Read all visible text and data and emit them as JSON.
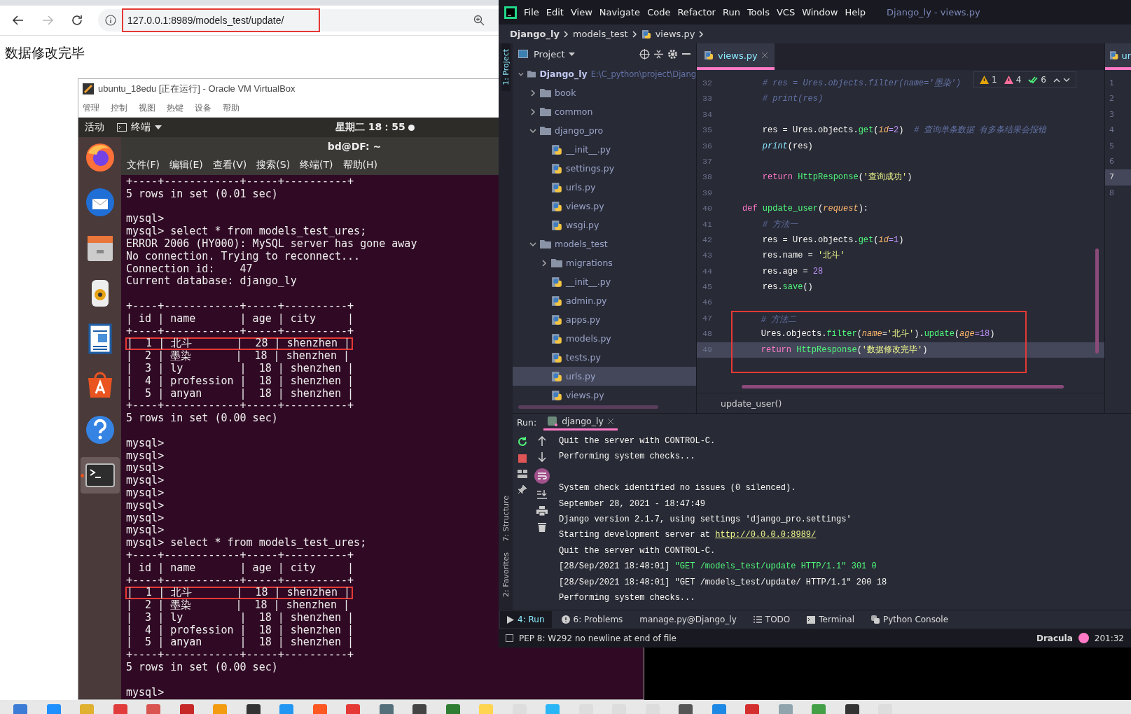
{
  "browser": {
    "nav": [
      {
        "kind": "back",
        "disabled": false
      },
      {
        "kind": "forward",
        "disabled": true
      },
      {
        "kind": "reload",
        "disabled": false
      }
    ],
    "address": "127.0.0.1:8989/models_test/update/",
    "address_highlighted": true,
    "page_text": "数据修改完毕"
  },
  "virtualbox": {
    "title": "ubuntu_18edu [正在运行] - Oracle VM VirtualBox",
    "menu": [
      "管理",
      "控制",
      "视图",
      "热键",
      "设备",
      "帮助"
    ],
    "top_bar": {
      "activities": "活动",
      "app": "终端",
      "clock": "星期二 18：55"
    },
    "dock": [
      {
        "kind": "firefox",
        "active": false
      },
      {
        "kind": "mail",
        "active": false
      },
      {
        "kind": "files",
        "active": false
      },
      {
        "kind": "speaker",
        "active": false
      },
      {
        "kind": "document",
        "active": false
      },
      {
        "kind": "store",
        "active": false
      },
      {
        "kind": "help",
        "active": false
      },
      {
        "kind": "terminal",
        "active": true
      }
    ],
    "terminal": {
      "title": "bd@DF: ~",
      "menu": [
        "文件(F)",
        "编辑(E)",
        "查看(V)",
        "搜索(S)",
        "终端(T)",
        "帮助(H)"
      ],
      "lines": [
        {
          "text": "+----+------------+-----+----------+",
          "highlighted": false
        },
        {
          "text": "5 rows in set (0.01 sec)",
          "highlighted": false
        },
        {
          "kind": "blank"
        },
        {
          "text": "mysql>",
          "highlighted": false
        },
        {
          "text": "mysql> select * from models_test_ures;",
          "highlighted": false
        },
        {
          "text": "ERROR 2006 (HY000): MySQL server has gone away",
          "highlighted": false
        },
        {
          "text": "No connection. Trying to reconnect...",
          "highlighted": false
        },
        {
          "text": "Connection id:    47",
          "highlighted": false
        },
        {
          "text": "Current database: django_ly",
          "highlighted": false
        },
        {
          "kind": "blank"
        },
        {
          "text": "+----+------------+-----+----------+",
          "highlighted": false
        },
        {
          "text": "| id | name       | age | city     |",
          "highlighted": false
        },
        {
          "text": "+----+------------+-----+----------+",
          "highlighted": false
        },
        {
          "text": "|  1 | 北斗       |  28 | shenzhen |",
          "highlighted": true
        },
        {
          "text": "|  2 | 墨染       |  18 | shenzhen |",
          "highlighted": false
        },
        {
          "text": "|  3 | ly         |  18 | shenzhen |",
          "highlighted": false
        },
        {
          "text": "|  4 | profession |  18 | shenzhen |",
          "highlighted": false
        },
        {
          "text": "|  5 | anyan      |  18 | shenzhen |",
          "highlighted": false
        },
        {
          "text": "+----+------------+-----+----------+",
          "highlighted": false
        },
        {
          "text": "5 rows in set (0.00 sec)",
          "highlighted": false
        },
        {
          "kind": "blank"
        },
        {
          "text": "mysql>",
          "highlighted": false
        },
        {
          "text": "mysql>",
          "highlighted": false
        },
        {
          "text": "mysql>",
          "highlighted": false
        },
        {
          "text": "mysql>",
          "highlighted": false
        },
        {
          "text": "mysql>",
          "highlighted": false
        },
        {
          "text": "mysql>",
          "highlighted": false
        },
        {
          "text": "mysql>",
          "highlighted": false
        },
        {
          "text": "mysql>",
          "highlighted": false
        },
        {
          "text": "mysql> select * from models_test_ures;",
          "highlighted": false
        },
        {
          "text": "+----+------------+-----+----------+",
          "highlighted": false
        },
        {
          "text": "| id | name       | age | city     |",
          "highlighted": false
        },
        {
          "text": "+----+------------+-----+----------+",
          "highlighted": false
        },
        {
          "text": "|  1 | 北斗       |  18 | shenzhen |",
          "highlighted": true
        },
        {
          "text": "|  2 | 墨染       |  18 | shenzhen |",
          "highlighted": false
        },
        {
          "text": "|  3 | ly         |  18 | shenzhen |",
          "highlighted": false
        },
        {
          "text": "|  4 | profession |  18 | shenzhen |",
          "highlighted": false
        },
        {
          "text": "|  5 | anyan      |  18 | shenzhen |",
          "highlighted": false
        },
        {
          "text": "+----+------------+-----+----------+",
          "highlighted": false
        },
        {
          "text": "5 rows in set (0.00 sec)",
          "highlighted": false
        },
        {
          "kind": "blank"
        },
        {
          "text": "mysql>",
          "highlighted": false
        }
      ]
    }
  },
  "pycharm": {
    "menu": [
      "File",
      "Edit",
      "View",
      "Navigate",
      "Code",
      "Refactor",
      "Run",
      "Tools",
      "VCS",
      "Window",
      "Help"
    ],
    "title": "Django_ly - views.py",
    "breadcrumb": [
      "Django_ly",
      "models_test",
      "views.py"
    ],
    "left_strip": [
      {
        "label": "1: Project",
        "selected": true
      },
      {
        "label": "7: Structure",
        "selected": false
      },
      {
        "label": "2: Favorites",
        "selected": false
      }
    ],
    "project": {
      "title": "Project",
      "tree": [
        {
          "label": "Django_ly",
          "path": "E:\\C_python\\project\\Djang",
          "kind": "root",
          "expanded": true,
          "selected": false,
          "children": [
            {
              "label": "book",
              "kind": "folder",
              "expanded": false,
              "selected": false
            },
            {
              "label": "common",
              "kind": "folder",
              "expanded": false,
              "selected": false
            },
            {
              "label": "django_pro",
              "kind": "folder",
              "expanded": true,
              "selected": false,
              "children": [
                {
                  "label": "__init__.py",
                  "kind": "python",
                  "selected": false
                },
                {
                  "label": "settings.py",
                  "kind": "python",
                  "selected": false
                },
                {
                  "label": "urls.py",
                  "kind": "python",
                  "selected": false
                },
                {
                  "label": "views.py",
                  "kind": "python",
                  "selected": false
                },
                {
                  "label": "wsgi.py",
                  "kind": "python",
                  "selected": false
                }
              ]
            },
            {
              "label": "models_test",
              "kind": "folder",
              "expanded": true,
              "selected": false,
              "children": [
                {
                  "label": "migrations",
                  "kind": "folder",
                  "expanded": false,
                  "selected": false
                },
                {
                  "label": "__init__.py",
                  "kind": "python",
                  "selected": false
                },
                {
                  "label": "admin.py",
                  "kind": "python",
                  "selected": false
                },
                {
                  "label": "apps.py",
                  "kind": "python",
                  "selected": false
                },
                {
                  "label": "models.py",
                  "kind": "python",
                  "selected": false
                },
                {
                  "label": "tests.py",
                  "kind": "python",
                  "selected": false
                },
                {
                  "label": "urls.py",
                  "kind": "python",
                  "selected": true
                },
                {
                  "label": "views.py",
                  "kind": "python",
                  "selected": false
                }
              ]
            }
          ]
        }
      ]
    },
    "editor": {
      "tab": {
        "label": "views.py",
        "selected": true
      },
      "inspections": [
        {
          "kind": "warning",
          "count": "1"
        },
        {
          "kind": "error",
          "count": "4"
        },
        {
          "kind": "ok",
          "count": "6"
        }
      ],
      "lines": [
        {
          "num": "32",
          "current": false,
          "boxed": false,
          "tokens": [
            {
              "kind": "cmt",
              "text": "    # res = Ures.objects.filter(name='墨染')"
            }
          ]
        },
        {
          "num": "33",
          "current": false,
          "boxed": false,
          "tokens": [
            {
              "kind": "cmt",
              "text": "    # print(res)"
            }
          ]
        },
        {
          "num": "34",
          "current": false,
          "boxed": false
        },
        {
          "num": "35",
          "current": false,
          "boxed": false,
          "tokens": [
            {
              "kind": "plain",
              "text": "    res = Ures.objects."
            },
            {
              "kind": "fn",
              "text": "get"
            },
            {
              "kind": "plain",
              "text": "("
            },
            {
              "kind": "param",
              "text": "id"
            },
            {
              "kind": "num",
              "text": "=2"
            },
            {
              "kind": "plain",
              "text": ")  "
            },
            {
              "kind": "cmt",
              "text": "# 查询单条数据 有多条结果会报错"
            }
          ]
        },
        {
          "num": "36",
          "current": false,
          "boxed": false,
          "tokens": [
            {
              "kind": "builtin",
              "text": "    print"
            },
            {
              "kind": "plain",
              "text": "(res)"
            }
          ]
        },
        {
          "num": "37",
          "current": false,
          "boxed": false
        },
        {
          "num": "38",
          "current": false,
          "boxed": false,
          "tokens": [
            {
              "kind": "kw",
              "text": "    return "
            },
            {
              "kind": "fn",
              "text": "HttpResponse"
            },
            {
              "kind": "plain",
              "text": "("
            },
            {
              "kind": "str",
              "text": "'查询成功'"
            },
            {
              "kind": "plain",
              "text": ")"
            }
          ]
        },
        {
          "num": "39",
          "current": false,
          "boxed": false
        },
        {
          "num": "40",
          "current": false,
          "boxed": false,
          "tokens": [
            {
              "kind": "kw",
              "text": "def "
            },
            {
              "kind": "fn",
              "text": "update_user"
            },
            {
              "kind": "plain",
              "text": "("
            },
            {
              "kind": "param",
              "text": "request"
            },
            {
              "kind": "plain",
              "text": "):"
            }
          ]
        },
        {
          "num": "41",
          "current": false,
          "boxed": false,
          "tokens": [
            {
              "kind": "cmt",
              "text": "    # 方法一"
            }
          ]
        },
        {
          "num": "42",
          "current": false,
          "boxed": false,
          "tokens": [
            {
              "kind": "plain",
              "text": "    res = Ures.objects."
            },
            {
              "kind": "fn",
              "text": "get"
            },
            {
              "kind": "plain",
              "text": "("
            },
            {
              "kind": "param",
              "text": "id"
            },
            {
              "kind": "num",
              "text": "=1"
            },
            {
              "kind": "plain",
              "text": ")"
            }
          ]
        },
        {
          "num": "43",
          "current": false,
          "boxed": false,
          "tokens": [
            {
              "kind": "plain",
              "text": "    res.name = "
            },
            {
              "kind": "str",
              "text": "'北斗'"
            }
          ]
        },
        {
          "num": "44",
          "current": false,
          "boxed": false,
          "tokens": [
            {
              "kind": "plain",
              "text": "    res.age = "
            },
            {
              "kind": "num",
              "text": "28"
            }
          ]
        },
        {
          "num": "45",
          "current": false,
          "boxed": false,
          "tokens": [
            {
              "kind": "plain",
              "text": "    res."
            },
            {
              "kind": "fn",
              "text": "save"
            },
            {
              "kind": "plain",
              "text": "()"
            }
          ]
        },
        {
          "num": "46",
          "current": false,
          "boxed": false
        },
        {
          "num": "47",
          "current": false,
          "boxed": true,
          "tokens": [
            {
              "kind": "cmt",
              "text": "    # 方法二"
            }
          ]
        },
        {
          "num": "48",
          "current": false,
          "boxed": true,
          "tokens": [
            {
              "kind": "plain",
              "text": "    Ures.objects."
            },
            {
              "kind": "fn",
              "text": "filter"
            },
            {
              "kind": "plain",
              "text": "("
            },
            {
              "kind": "param",
              "text": "name"
            },
            {
              "kind": "plain",
              "text": "="
            },
            {
              "kind": "str",
              "text": "'北斗'"
            },
            {
              "kind": "plain",
              "text": ")."
            },
            {
              "kind": "fn",
              "text": "update"
            },
            {
              "kind": "plain",
              "text": "("
            },
            {
              "kind": "param",
              "text": "age"
            },
            {
              "kind": "num",
              "text": "=18"
            },
            {
              "kind": "plain",
              "text": ")"
            }
          ]
        },
        {
          "num": "49",
          "current": true,
          "boxed": true,
          "tokens": [
            {
              "kind": "kw",
              "text": "    return "
            },
            {
              "kind": "fn",
              "text": "HttpResponse"
            },
            {
              "kind": "plain",
              "text": "("
            },
            {
              "kind": "str",
              "text": "'数据修改完毕'"
            },
            {
              "kind": "plain",
              "text": ")"
            }
          ]
        }
      ],
      "breadcrumb": "update_user()"
    },
    "split_editor": {
      "tab": "ur",
      "lines": [
        {
          "num": "1",
          "current": false
        },
        {
          "num": "2",
          "current": false
        },
        {
          "num": "3",
          "current": false
        },
        {
          "num": "4",
          "current": false
        },
        {
          "num": "5",
          "current": false
        },
        {
          "num": "6",
          "current": false
        },
        {
          "num": "7",
          "current": true
        },
        {
          "num": "8",
          "current": false
        }
      ]
    },
    "run": {
      "label": "Run:",
      "tab": "django_ly",
      "lines": [
        {
          "kind": "plain",
          "parts": [
            {
              "kind": "plain",
              "text": "Quit the server with CONTROL-C."
            }
          ]
        },
        {
          "kind": "plain",
          "parts": [
            {
              "kind": "plain",
              "text": "Performing system checks..."
            }
          ]
        },
        {
          "kind": "blank"
        },
        {
          "kind": "plain",
          "parts": [
            {
              "kind": "plain",
              "text": "System check identified no issues (0 silenced)."
            }
          ]
        },
        {
          "kind": "plain",
          "parts": [
            {
              "kind": "plain",
              "text": "September 28, 2021 - 18:47:49"
            }
          ]
        },
        {
          "kind": "plain",
          "parts": [
            {
              "kind": "plain",
              "text": "Django version 2.1.7, using settings 'django_pro.settings'"
            }
          ]
        },
        {
          "kind": "plain",
          "parts": [
            {
              "kind": "plain",
              "text": "Starting development server at "
            },
            {
              "kind": "link",
              "text": "http://0.0.0.0:8989/"
            }
          ]
        },
        {
          "kind": "plain",
          "parts": [
            {
              "kind": "plain",
              "text": "Quit the server with CONTROL-C."
            }
          ]
        },
        {
          "kind": "plain",
          "parts": [
            {
              "kind": "plain",
              "text": "[28/Sep/2021 18:48:01] "
            },
            {
              "kind": "green",
              "text": "\"GET /models_test/update HTTP/1.1\" 301 0"
            }
          ]
        },
        {
          "kind": "plain",
          "parts": [
            {
              "kind": "plain",
              "text": "[28/Sep/2021 18:48:01] \"GET /models_test/update/ HTTP/1.1\" 200 18"
            }
          ]
        },
        {
          "kind": "plain",
          "parts": [
            {
              "kind": "plain",
              "text": "Performing system checks..."
            }
          ]
        }
      ]
    },
    "tool_tabs": [
      {
        "kind": "run",
        "label": "4: Run",
        "selected": true
      },
      {
        "kind": "problems",
        "label": "6: Problems",
        "selected": false
      },
      {
        "kind": "none",
        "label": "manage.py@Django_ly",
        "selected": false
      },
      {
        "kind": "todo",
        "label": "TODO",
        "selected": false
      },
      {
        "kind": "terminal",
        "label": "Terminal",
        "selected": false
      },
      {
        "kind": "python",
        "label": "Python Console",
        "selected": false
      }
    ],
    "status": {
      "message": "PEP 8: W292 no newline at end of file",
      "theme": "Dracula",
      "position": "201:32"
    }
  }
}
